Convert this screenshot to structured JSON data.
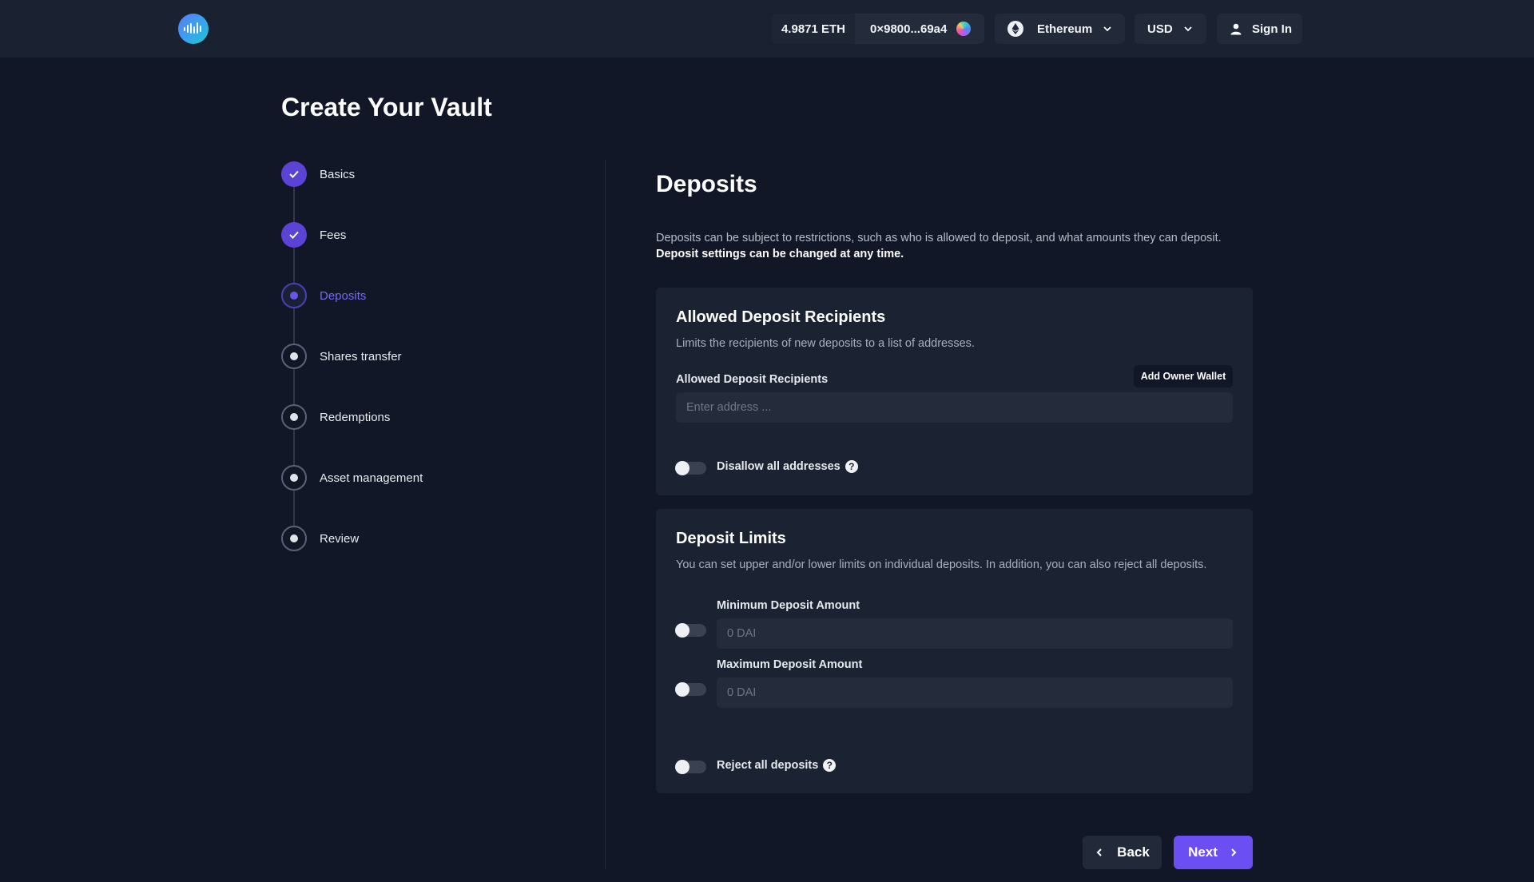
{
  "topbar": {
    "logo_icon": "waveform-logo-icon",
    "balance": "4.9871 ETH",
    "wallet_address": "0×9800...69a4",
    "network": "Ethereum",
    "currency": "USD",
    "sign_in": "Sign In"
  },
  "page": {
    "title": "Create Your Vault"
  },
  "stepper": {
    "steps": [
      {
        "label": "Basics",
        "state": "done"
      },
      {
        "label": "Fees",
        "state": "done"
      },
      {
        "label": "Deposits",
        "state": "current"
      },
      {
        "label": "Shares transfer",
        "state": "pending"
      },
      {
        "label": "Redemptions",
        "state": "pending"
      },
      {
        "label": "Asset management",
        "state": "pending"
      },
      {
        "label": "Review",
        "state": "pending"
      }
    ]
  },
  "deposits": {
    "title": "Deposits",
    "description": "Deposits can be subject to restrictions, such as who is allowed to deposit, and what amounts they can deposit.",
    "description_bold": "Deposit settings can be changed at any time.",
    "recipients_card": {
      "title": "Allowed Deposit Recipients",
      "subtitle": "Limits the recipients of new deposits to a list of addresses.",
      "field_label": "Allowed Deposit Recipients",
      "add_owner_label": "Add Owner Wallet",
      "address_placeholder": "Enter address ...",
      "address_value": "",
      "disallow_label": "Disallow all addresses",
      "disallow_on": false
    },
    "limits_card": {
      "title": "Deposit Limits",
      "subtitle": "You can set upper and/or lower limits on individual deposits. In addition, you can also reject all deposits.",
      "min_label": "Minimum Deposit Amount",
      "min_placeholder": "0 DAI",
      "min_on": false,
      "max_label": "Maximum Deposit Amount",
      "max_placeholder": "0 DAI",
      "max_on": false,
      "reject_label": "Reject all deposits",
      "reject_on": false
    }
  },
  "nav": {
    "back_label": "Back",
    "next_label": "Next"
  },
  "colors": {
    "accent": "#6c4ff2",
    "background": "#111726",
    "card": "#1b2231"
  }
}
